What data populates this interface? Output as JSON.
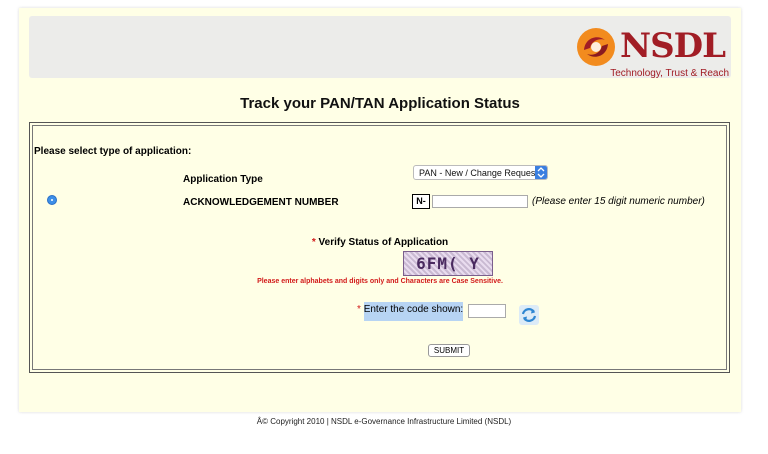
{
  "header": {
    "logo_text": "NSDL",
    "logo_tagline": "Technology, Trust & Reach"
  },
  "page": {
    "title": "Track your PAN/TAN Application Status"
  },
  "form": {
    "select_type_label": "Please select type of application:",
    "application_type": {
      "label": "Application Type",
      "selected": "PAN - New / Change Request"
    },
    "acknowledgement": {
      "label": "ACKNOWLEDGEMENT NUMBER",
      "prefix": "N-",
      "value": "",
      "hint": "(Please enter 15 digit numeric number)"
    },
    "verify": {
      "required_mark": "*",
      "title": "Verify Status of Application",
      "captcha_text": "6FM( Y",
      "note": "Please enter alphabets and digits only and Characters are Case Sensitive.",
      "code_label": "Enter the code shown:",
      "code_value": ""
    },
    "submit_label": "SUBMIT"
  },
  "footer": {
    "copyright": "Â© Copyright 2010  |  NSDL e-Governance Infrastructure Limited (NSDL)"
  },
  "colors": {
    "page_bg": "#ffffe6",
    "brand_red": "#a11d25",
    "brand_orange": "#f28b1e",
    "required_red": "#d21a1a",
    "selection_blue": "#b7d4f3"
  }
}
